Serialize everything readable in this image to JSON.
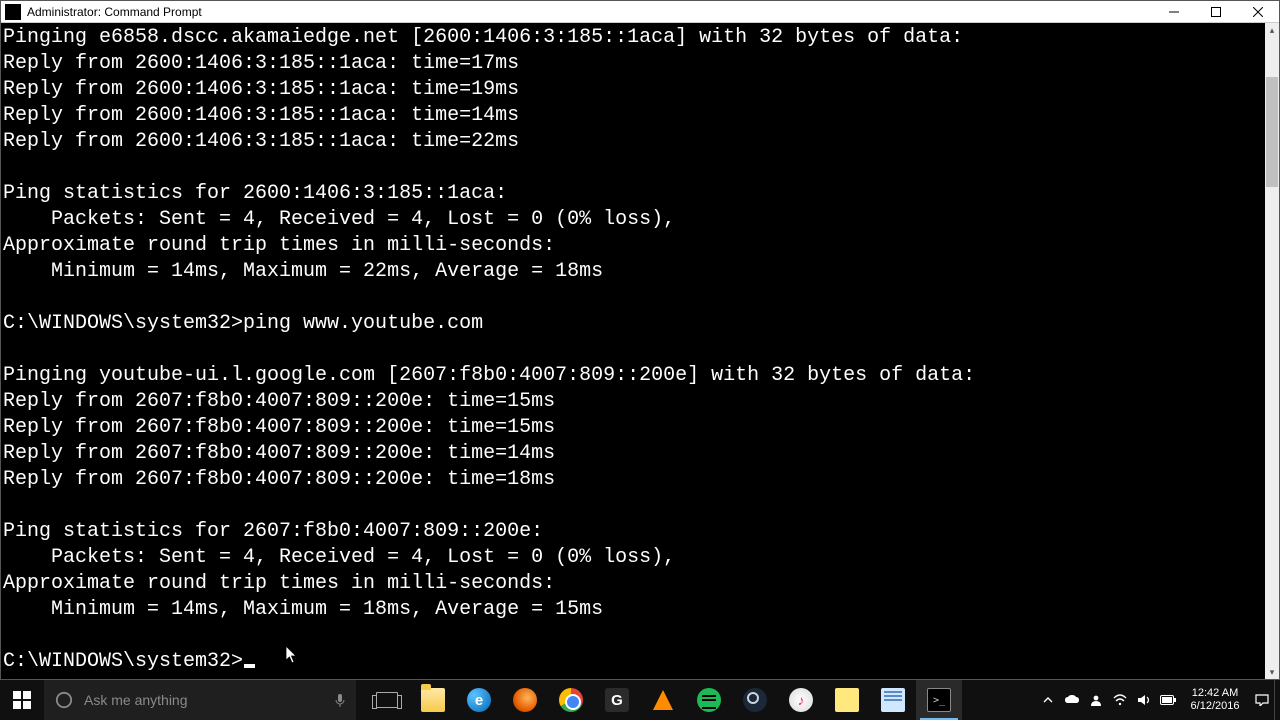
{
  "window": {
    "title": "Administrator: Command Prompt"
  },
  "terminal": {
    "lines": [
      "Pinging e6858.dscc.akamaiedge.net [2600:1406:3:185::1aca] with 32 bytes of data:",
      "Reply from 2600:1406:3:185::1aca: time=17ms",
      "Reply from 2600:1406:3:185::1aca: time=19ms",
      "Reply from 2600:1406:3:185::1aca: time=14ms",
      "Reply from 2600:1406:3:185::1aca: time=22ms",
      "",
      "Ping statistics for 2600:1406:3:185::1aca:",
      "    Packets: Sent = 4, Received = 4, Lost = 0 (0% loss),",
      "Approximate round trip times in milli-seconds:",
      "    Minimum = 14ms, Maximum = 22ms, Average = 18ms",
      "",
      "C:\\WINDOWS\\system32>ping www.youtube.com",
      "",
      "Pinging youtube-ui.l.google.com [2607:f8b0:4007:809::200e] with 32 bytes of data:",
      "Reply from 2607:f8b0:4007:809::200e: time=15ms",
      "Reply from 2607:f8b0:4007:809::200e: time=15ms",
      "Reply from 2607:f8b0:4007:809::200e: time=14ms",
      "Reply from 2607:f8b0:4007:809::200e: time=18ms",
      "",
      "Ping statistics for 2607:f8b0:4007:809::200e:",
      "    Packets: Sent = 4, Received = 4, Lost = 0 (0% loss),",
      "Approximate round trip times in milli-seconds:",
      "    Minimum = 14ms, Maximum = 18ms, Average = 15ms",
      ""
    ],
    "prompt": "C:\\WINDOWS\\system32>"
  },
  "taskbar": {
    "search_placeholder": "Ask me anything",
    "apps": [
      {
        "name": "task-view",
        "label": "Task view"
      },
      {
        "name": "file-explorer",
        "label": "File Explorer"
      },
      {
        "name": "edge",
        "label": "Microsoft Edge"
      },
      {
        "name": "firefox",
        "label": "Firefox"
      },
      {
        "name": "chrome",
        "label": "Google Chrome"
      },
      {
        "name": "grammarly",
        "label": "G"
      },
      {
        "name": "vlc",
        "label": "VLC"
      },
      {
        "name": "spotify",
        "label": "Spotify"
      },
      {
        "name": "steam",
        "label": "Steam"
      },
      {
        "name": "itunes",
        "label": "iTunes"
      },
      {
        "name": "sticky-notes",
        "label": "Sticky Notes"
      },
      {
        "name": "notepad",
        "label": "Notepad"
      },
      {
        "name": "cmd",
        "label": "Command Prompt",
        "active": true
      }
    ],
    "tray": {
      "time": "12:42 AM",
      "date": "6/12/2016"
    }
  }
}
